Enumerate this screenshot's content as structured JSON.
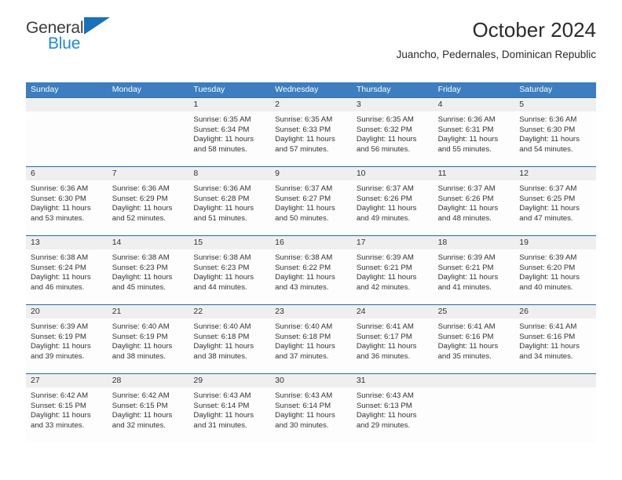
{
  "brand": {
    "line1": "General",
    "line2": "Blue",
    "triangle_color": "#1771bd",
    "blue_text_color": "#1e8ade"
  },
  "header": {
    "title": "October 2024",
    "subtitle": "Juancho, Pedernales, Dominican Republic"
  },
  "colors": {
    "header_blue": "#3c7ebf",
    "row_rule_blue": "#1f6db4",
    "daynum_band_gray": "#efefef",
    "text": "#333333"
  },
  "weekdays": [
    "Sunday",
    "Monday",
    "Tuesday",
    "Wednesday",
    "Thursday",
    "Friday",
    "Saturday"
  ],
  "labels": {
    "sunrise_prefix": "Sunrise:",
    "sunset_prefix": "Sunset:",
    "daylight_prefix": "Daylight:"
  },
  "weeks": [
    [
      {
        "day": "",
        "empty": true
      },
      {
        "day": "",
        "empty": true
      },
      {
        "day": "1",
        "sunrise": "Sunrise: 6:35 AM",
        "sunset": "Sunset: 6:34 PM",
        "daylight_l1": "Daylight: 11 hours",
        "daylight_l2": "and 58 minutes."
      },
      {
        "day": "2",
        "sunrise": "Sunrise: 6:35 AM",
        "sunset": "Sunset: 6:33 PM",
        "daylight_l1": "Daylight: 11 hours",
        "daylight_l2": "and 57 minutes."
      },
      {
        "day": "3",
        "sunrise": "Sunrise: 6:35 AM",
        "sunset": "Sunset: 6:32 PM",
        "daylight_l1": "Daylight: 11 hours",
        "daylight_l2": "and 56 minutes."
      },
      {
        "day": "4",
        "sunrise": "Sunrise: 6:36 AM",
        "sunset": "Sunset: 6:31 PM",
        "daylight_l1": "Daylight: 11 hours",
        "daylight_l2": "and 55 minutes."
      },
      {
        "day": "5",
        "sunrise": "Sunrise: 6:36 AM",
        "sunset": "Sunset: 6:30 PM",
        "daylight_l1": "Daylight: 11 hours",
        "daylight_l2": "and 54 minutes."
      }
    ],
    [
      {
        "day": "6",
        "sunrise": "Sunrise: 6:36 AM",
        "sunset": "Sunset: 6:30 PM",
        "daylight_l1": "Daylight: 11 hours",
        "daylight_l2": "and 53 minutes."
      },
      {
        "day": "7",
        "sunrise": "Sunrise: 6:36 AM",
        "sunset": "Sunset: 6:29 PM",
        "daylight_l1": "Daylight: 11 hours",
        "daylight_l2": "and 52 minutes."
      },
      {
        "day": "8",
        "sunrise": "Sunrise: 6:36 AM",
        "sunset": "Sunset: 6:28 PM",
        "daylight_l1": "Daylight: 11 hours",
        "daylight_l2": "and 51 minutes."
      },
      {
        "day": "9",
        "sunrise": "Sunrise: 6:37 AM",
        "sunset": "Sunset: 6:27 PM",
        "daylight_l1": "Daylight: 11 hours",
        "daylight_l2": "and 50 minutes."
      },
      {
        "day": "10",
        "sunrise": "Sunrise: 6:37 AM",
        "sunset": "Sunset: 6:26 PM",
        "daylight_l1": "Daylight: 11 hours",
        "daylight_l2": "and 49 minutes."
      },
      {
        "day": "11",
        "sunrise": "Sunrise: 6:37 AM",
        "sunset": "Sunset: 6:26 PM",
        "daylight_l1": "Daylight: 11 hours",
        "daylight_l2": "and 48 minutes."
      },
      {
        "day": "12",
        "sunrise": "Sunrise: 6:37 AM",
        "sunset": "Sunset: 6:25 PM",
        "daylight_l1": "Daylight: 11 hours",
        "daylight_l2": "and 47 minutes."
      }
    ],
    [
      {
        "day": "13",
        "sunrise": "Sunrise: 6:38 AM",
        "sunset": "Sunset: 6:24 PM",
        "daylight_l1": "Daylight: 11 hours",
        "daylight_l2": "and 46 minutes."
      },
      {
        "day": "14",
        "sunrise": "Sunrise: 6:38 AM",
        "sunset": "Sunset: 6:23 PM",
        "daylight_l1": "Daylight: 11 hours",
        "daylight_l2": "and 45 minutes."
      },
      {
        "day": "15",
        "sunrise": "Sunrise: 6:38 AM",
        "sunset": "Sunset: 6:23 PM",
        "daylight_l1": "Daylight: 11 hours",
        "daylight_l2": "and 44 minutes."
      },
      {
        "day": "16",
        "sunrise": "Sunrise: 6:38 AM",
        "sunset": "Sunset: 6:22 PM",
        "daylight_l1": "Daylight: 11 hours",
        "daylight_l2": "and 43 minutes."
      },
      {
        "day": "17",
        "sunrise": "Sunrise: 6:39 AM",
        "sunset": "Sunset: 6:21 PM",
        "daylight_l1": "Daylight: 11 hours",
        "daylight_l2": "and 42 minutes."
      },
      {
        "day": "18",
        "sunrise": "Sunrise: 6:39 AM",
        "sunset": "Sunset: 6:21 PM",
        "daylight_l1": "Daylight: 11 hours",
        "daylight_l2": "and 41 minutes."
      },
      {
        "day": "19",
        "sunrise": "Sunrise: 6:39 AM",
        "sunset": "Sunset: 6:20 PM",
        "daylight_l1": "Daylight: 11 hours",
        "daylight_l2": "and 40 minutes."
      }
    ],
    [
      {
        "day": "20",
        "sunrise": "Sunrise: 6:39 AM",
        "sunset": "Sunset: 6:19 PM",
        "daylight_l1": "Daylight: 11 hours",
        "daylight_l2": "and 39 minutes."
      },
      {
        "day": "21",
        "sunrise": "Sunrise: 6:40 AM",
        "sunset": "Sunset: 6:19 PM",
        "daylight_l1": "Daylight: 11 hours",
        "daylight_l2": "and 38 minutes."
      },
      {
        "day": "22",
        "sunrise": "Sunrise: 6:40 AM",
        "sunset": "Sunset: 6:18 PM",
        "daylight_l1": "Daylight: 11 hours",
        "daylight_l2": "and 38 minutes."
      },
      {
        "day": "23",
        "sunrise": "Sunrise: 6:40 AM",
        "sunset": "Sunset: 6:18 PM",
        "daylight_l1": "Daylight: 11 hours",
        "daylight_l2": "and 37 minutes."
      },
      {
        "day": "24",
        "sunrise": "Sunrise: 6:41 AM",
        "sunset": "Sunset: 6:17 PM",
        "daylight_l1": "Daylight: 11 hours",
        "daylight_l2": "and 36 minutes."
      },
      {
        "day": "25",
        "sunrise": "Sunrise: 6:41 AM",
        "sunset": "Sunset: 6:16 PM",
        "daylight_l1": "Daylight: 11 hours",
        "daylight_l2": "and 35 minutes."
      },
      {
        "day": "26",
        "sunrise": "Sunrise: 6:41 AM",
        "sunset": "Sunset: 6:16 PM",
        "daylight_l1": "Daylight: 11 hours",
        "daylight_l2": "and 34 minutes."
      }
    ],
    [
      {
        "day": "27",
        "sunrise": "Sunrise: 6:42 AM",
        "sunset": "Sunset: 6:15 PM",
        "daylight_l1": "Daylight: 11 hours",
        "daylight_l2": "and 33 minutes."
      },
      {
        "day": "28",
        "sunrise": "Sunrise: 6:42 AM",
        "sunset": "Sunset: 6:15 PM",
        "daylight_l1": "Daylight: 11 hours",
        "daylight_l2": "and 32 minutes."
      },
      {
        "day": "29",
        "sunrise": "Sunrise: 6:43 AM",
        "sunset": "Sunset: 6:14 PM",
        "daylight_l1": "Daylight: 11 hours",
        "daylight_l2": "and 31 minutes."
      },
      {
        "day": "30",
        "sunrise": "Sunrise: 6:43 AM",
        "sunset": "Sunset: 6:14 PM",
        "daylight_l1": "Daylight: 11 hours",
        "daylight_l2": "and 30 minutes."
      },
      {
        "day": "31",
        "sunrise": "Sunrise: 6:43 AM",
        "sunset": "Sunset: 6:13 PM",
        "daylight_l1": "Daylight: 11 hours",
        "daylight_l2": "and 29 minutes."
      },
      {
        "day": "",
        "empty": true
      },
      {
        "day": "",
        "empty": true
      }
    ]
  ]
}
